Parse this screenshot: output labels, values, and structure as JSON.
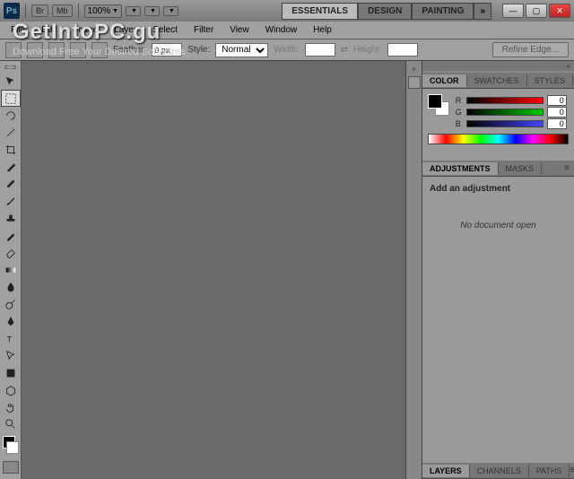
{
  "titlebar": {
    "zoom": "100%",
    "br_label": "Br",
    "mb_label": "Mb"
  },
  "workspace_tabs": [
    "ESSENTIALS",
    "DESIGN",
    "PAINTING"
  ],
  "menu": [
    "File",
    "Edit",
    "Image",
    "Layer",
    "Select",
    "Filter",
    "View",
    "Window",
    "Help"
  ],
  "options": {
    "feather_label": "Feather:",
    "feather_value": "0 px",
    "style_label": "Style:",
    "style_value": "Normal",
    "width_label": "Width:",
    "height_label": "Height:",
    "refine": "Refine Edge..."
  },
  "panels": {
    "color_tabs": [
      "COLOR",
      "SWATCHES",
      "STYLES"
    ],
    "rgb": {
      "r_label": "R",
      "g_label": "G",
      "b_label": "B",
      "r": "0",
      "g": "0",
      "b": "0"
    },
    "adj_tabs": [
      "ADJUSTMENTS",
      "MASKS"
    ],
    "adj_title": "Add an adjustment",
    "no_doc": "No document open",
    "layers_tabs": [
      "LAYERS",
      "CHANNELS",
      "PATHS"
    ]
  },
  "watermark": {
    "title": "GetIntoPC.gu",
    "sub": "Download Free Your Desired Softwares"
  }
}
